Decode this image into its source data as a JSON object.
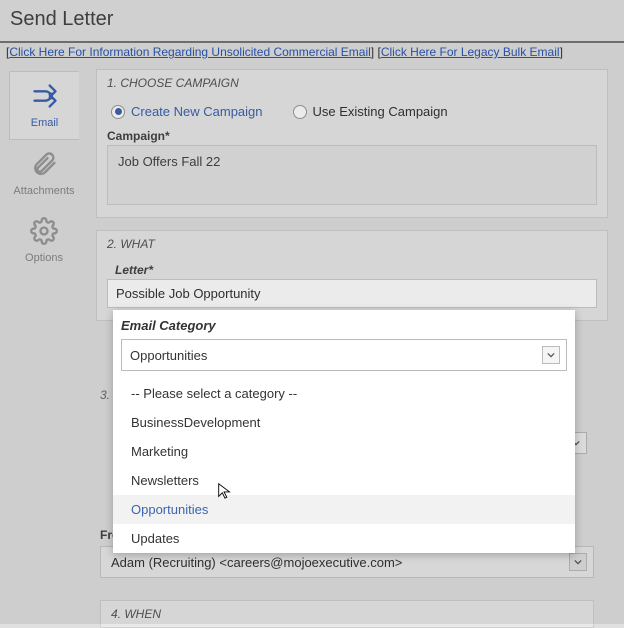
{
  "page_title": "Send Letter",
  "top_links": {
    "link1": "Click Here For Information Regarding Unsolicited Commercial Email",
    "link2": "Click Here For Legacy Bulk Email"
  },
  "sidebar": {
    "tab_email": "Email",
    "tab_attachments": "Attachments",
    "tab_options": "Options"
  },
  "step1": {
    "head": "1. CHOOSE CAMPAIGN",
    "radio_create": "Create New Campaign",
    "radio_existing": "Use Existing Campaign",
    "campaign_label": "Campaign*",
    "campaign_value": "Job Offers Fall 22"
  },
  "step2": {
    "head": "2. WHAT",
    "letter_label": "Letter*",
    "letter_value": "Possible Job Opportunity"
  },
  "category_popup": {
    "title": "Email Category",
    "selected": "Opportunities",
    "options": {
      "o0": "-- Please select a category --",
      "o1": "BusinessDevelopment",
      "o2": "Marketing",
      "o3": "Newsletters",
      "o4": "Opportunities",
      "o5": "Updates"
    }
  },
  "step3_hidden": {
    "head": "3."
  },
  "from": {
    "label": "From",
    "value": "Adam (Recruiting) <careers@mojoexecutive.com>"
  },
  "step4": {
    "head": "4. WHEN"
  }
}
